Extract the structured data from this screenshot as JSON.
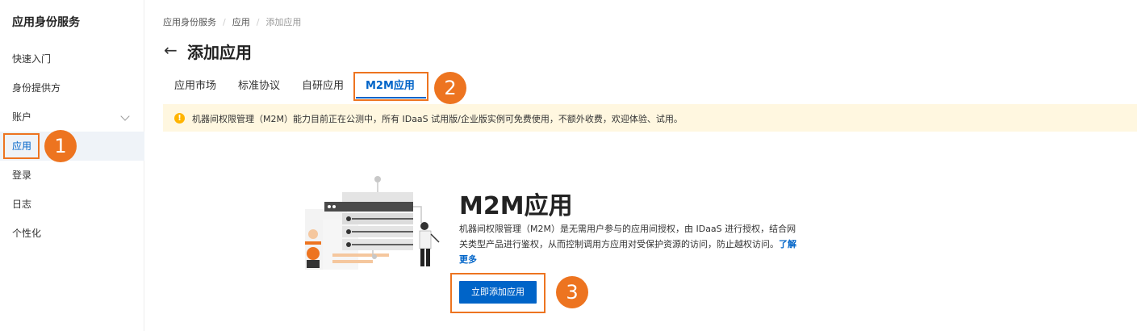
{
  "sidebar": {
    "title": "应用身份服务",
    "items": [
      {
        "label": "快速入门"
      },
      {
        "label": "身份提供方"
      },
      {
        "label": "账户"
      },
      {
        "label": "应用"
      },
      {
        "label": "登录"
      },
      {
        "label": "日志"
      },
      {
        "label": "个性化"
      }
    ]
  },
  "breadcrumb": [
    "应用身份服务",
    "应用",
    "添加应用"
  ],
  "page": {
    "title": "添加应用"
  },
  "tabs": [
    {
      "label": "应用市场"
    },
    {
      "label": "标准协议"
    },
    {
      "label": "自研应用"
    },
    {
      "label": "M2M应用"
    }
  ],
  "notice": {
    "text": "机器间权限管理（M2M）能力目前正在公测中，所有 IDaaS 试用版/企业版实例可免费使用，不额外收费，欢迎体验、试用。"
  },
  "m2m": {
    "title": "M2M应用",
    "description": "机器间权限管理（M2M）是无需用户参与的应用间授权，由 IDaaS 进行授权，结合网关类型产品进行鉴权，从而控制调用方应用对受保护资源的访问，防止越权访问。",
    "learn_more": "了解更多",
    "add_button": "立即添加应用"
  },
  "annotations": [
    "1",
    "2",
    "3"
  ],
  "colors": {
    "accent": "#0064c8",
    "highlight": "#ed7420",
    "notice_bg": "#fff7e0"
  }
}
